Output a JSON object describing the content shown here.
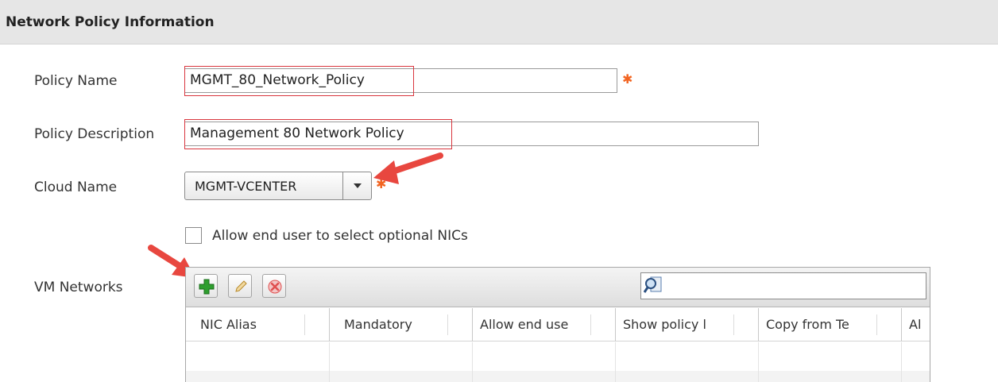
{
  "section": {
    "title": "Network Policy Information"
  },
  "form": {
    "policy_name": {
      "label": "Policy Name",
      "value": "MGMT_80_Network_Policy",
      "required": "✱"
    },
    "policy_description": {
      "label": "Policy Description",
      "value": "Management 80 Network Policy"
    },
    "cloud_name": {
      "label": "Cloud Name",
      "value": "MGMT-VCENTER",
      "required": "✱"
    },
    "allow_optional_nics": {
      "label": "Allow end user to select optional NICs",
      "checked": false
    },
    "vm_networks": {
      "label": "VM Networks"
    }
  },
  "grid": {
    "toolbar": {
      "add_icon": "plus-icon",
      "edit_icon": "pencil-icon",
      "delete_icon": "delete-icon",
      "search_icon": "search-icon",
      "search_value": ""
    },
    "columns": [
      {
        "label": "NIC Alias"
      },
      {
        "label": "Mandatory"
      },
      {
        "label": "Allow end use"
      },
      {
        "label": "Show policy l"
      },
      {
        "label": "Copy from Te"
      },
      {
        "label": "Al"
      }
    ]
  },
  "colors": {
    "highlight": "#d9363e",
    "required": "#f26522",
    "annotation_arrow": "#e8473f",
    "add_green": "#2e9e2e",
    "delete_red": "#e05050"
  }
}
